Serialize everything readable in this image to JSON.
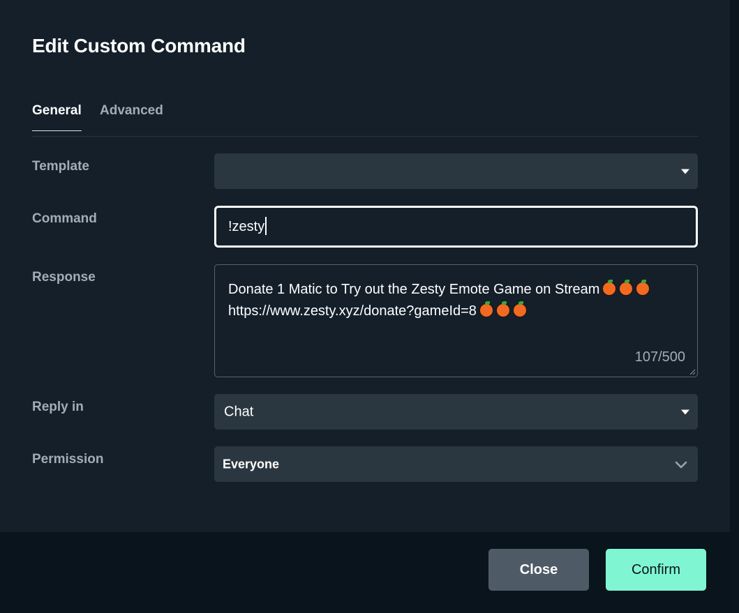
{
  "dialog": {
    "title": "Edit Custom Command"
  },
  "tabs": [
    {
      "label": "General",
      "active": true
    },
    {
      "label": "Advanced",
      "active": false
    }
  ],
  "fields": {
    "template": {
      "label": "Template",
      "value": ""
    },
    "command": {
      "label": "Command",
      "value": "!zesty"
    },
    "response": {
      "label": "Response",
      "line1": "Donate 1 Matic to Try out the Zesty Emote Game on Stream",
      "line2": "https://www.zesty.xyz/donate?gameId=8",
      "emoji": "tangerine-emoji",
      "counter": "107/500"
    },
    "reply_in": {
      "label": "Reply in",
      "value": "Chat"
    },
    "permission": {
      "label": "Permission",
      "value": "Everyone"
    }
  },
  "footer": {
    "close_label": "Close",
    "confirm_label": "Confirm"
  },
  "colors": {
    "background": "#141f2a",
    "footer": "#09141c",
    "input": "#2b3740",
    "confirm": "#80f5d2",
    "close": "#4e5b66"
  }
}
